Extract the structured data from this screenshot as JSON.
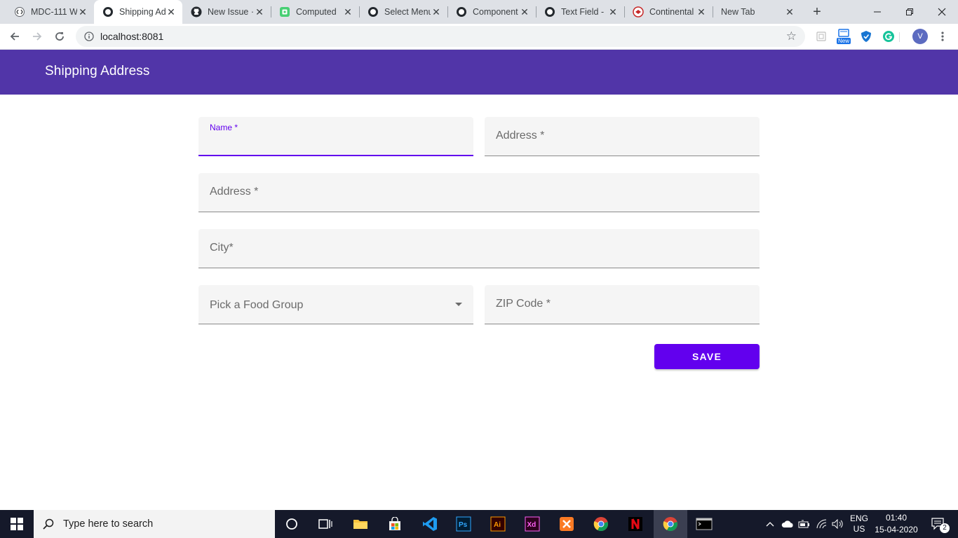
{
  "browser": {
    "tabs": [
      {
        "title": "MDC-111 W",
        "icon": "code-brackets-icon"
      },
      {
        "title": "Shipping Ad",
        "icon": "generic-site-icon",
        "active": true
      },
      {
        "title": "New Issue ·",
        "icon": "github-icon"
      },
      {
        "title": "Computed",
        "icon": "codepen-icon"
      },
      {
        "title": "Select Menu",
        "icon": "generic-site-icon"
      },
      {
        "title": "Component",
        "icon": "generic-site-icon"
      },
      {
        "title": "Text Field -",
        "icon": "generic-site-icon"
      },
      {
        "title": "Continental",
        "icon": "red-site-icon"
      },
      {
        "title": "New Tab",
        "icon": "none"
      }
    ],
    "new_tab_glyph": "+",
    "url": "localhost:8081",
    "profile_initial": "V",
    "extension_badge": "New"
  },
  "app": {
    "title": "Shipping Address"
  },
  "form": {
    "name_label": "Name *",
    "address1_label": "Address *",
    "address2_label": "Address *",
    "city_label": "City*",
    "food_group_label": "Pick a Food Group",
    "zip_label": "ZIP Code *",
    "save_label": "SAVE"
  },
  "colors": {
    "app_bar": "#5135a8",
    "primary": "#6200ee"
  },
  "taskbar": {
    "search_placeholder": "Type here to search",
    "lang_line1": "ENG",
    "lang_line2": "US",
    "time": "01:40",
    "date": "15-04-2020",
    "notification_count": "2"
  }
}
